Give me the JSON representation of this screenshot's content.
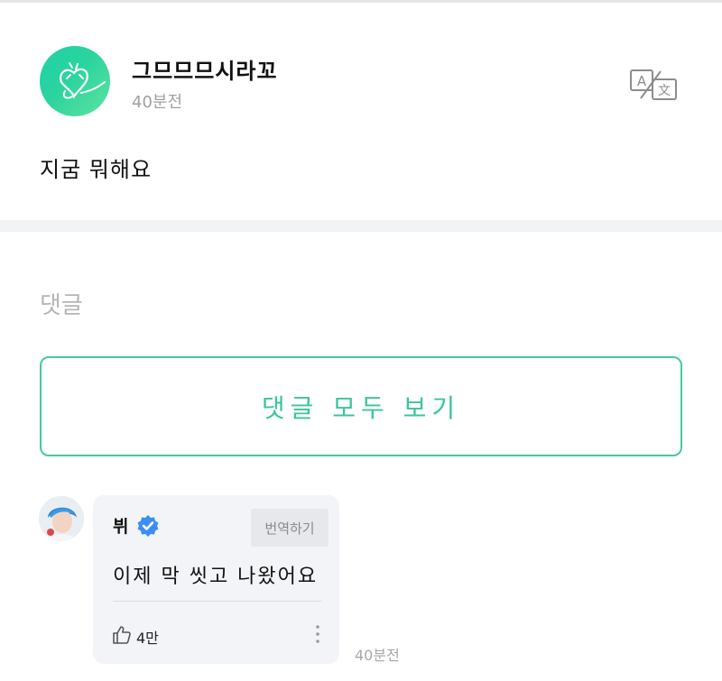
{
  "post": {
    "author": "그므므므시라꼬",
    "time": "40분전",
    "text": "지굼 뭐해요",
    "translate_icon": "translate-icon"
  },
  "comments": {
    "heading": "댓글",
    "view_all_label": "댓글 모두 보기",
    "items": [
      {
        "author": "뷔",
        "verified": true,
        "translate_label": "번역하기",
        "text": "이제 막 씻고 나왔어요",
        "likes": "4만",
        "time": "40분전"
      }
    ]
  },
  "colors": {
    "accent": "#3cc49b",
    "verified": "#3b8ff0"
  }
}
